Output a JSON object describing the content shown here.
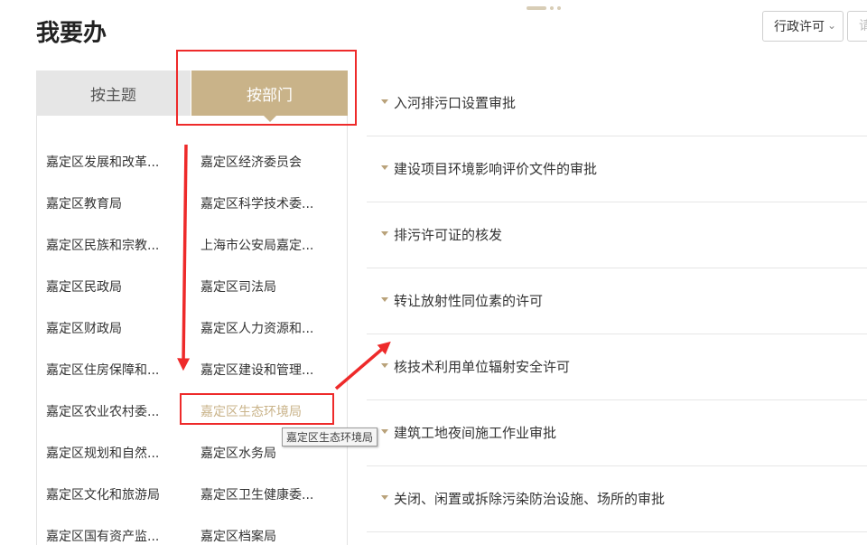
{
  "header": {
    "title": "我要办",
    "filter": {
      "selected": "行政许可"
    },
    "search": {
      "placeholder": "请"
    }
  },
  "tabs": [
    {
      "label": "按主题",
      "active": false
    },
    {
      "label": "按部门",
      "active": true
    }
  ],
  "departments": [
    "嘉定区发展和改革...",
    "嘉定区经济委员会",
    "嘉定区教育局",
    "嘉定区科学技术委...",
    "嘉定区民族和宗教...",
    "上海市公安局嘉定...",
    "嘉定区民政局",
    "嘉定区司法局",
    "嘉定区财政局",
    "嘉定区人力资源和...",
    "嘉定区住房保障和...",
    "嘉定区建设和管理...",
    "嘉定区农业农村委...",
    "嘉定区生态环境局",
    "嘉定区规划和自然...",
    "嘉定区水务局",
    "嘉定区文化和旅游局",
    "嘉定区卫生健康委...",
    "嘉定区国有资产监...",
    "嘉定区档案局"
  ],
  "selected_department_index": 13,
  "tooltip": "嘉定区生态环境局",
  "services": [
    "入河排污口设置审批",
    "建设项目环境影响评价文件的审批",
    "排污许可证的核发",
    "转让放射性同位素的许可",
    "核技术利用单位辐射安全许可",
    "建筑工地夜间施工作业审批",
    "关闭、闲置或拆除污染防治设施、场所的审批"
  ],
  "colors": {
    "accent": "#c9b389",
    "tab_inactive": "#e6e6e6",
    "annotation": "#ee2a2a"
  }
}
